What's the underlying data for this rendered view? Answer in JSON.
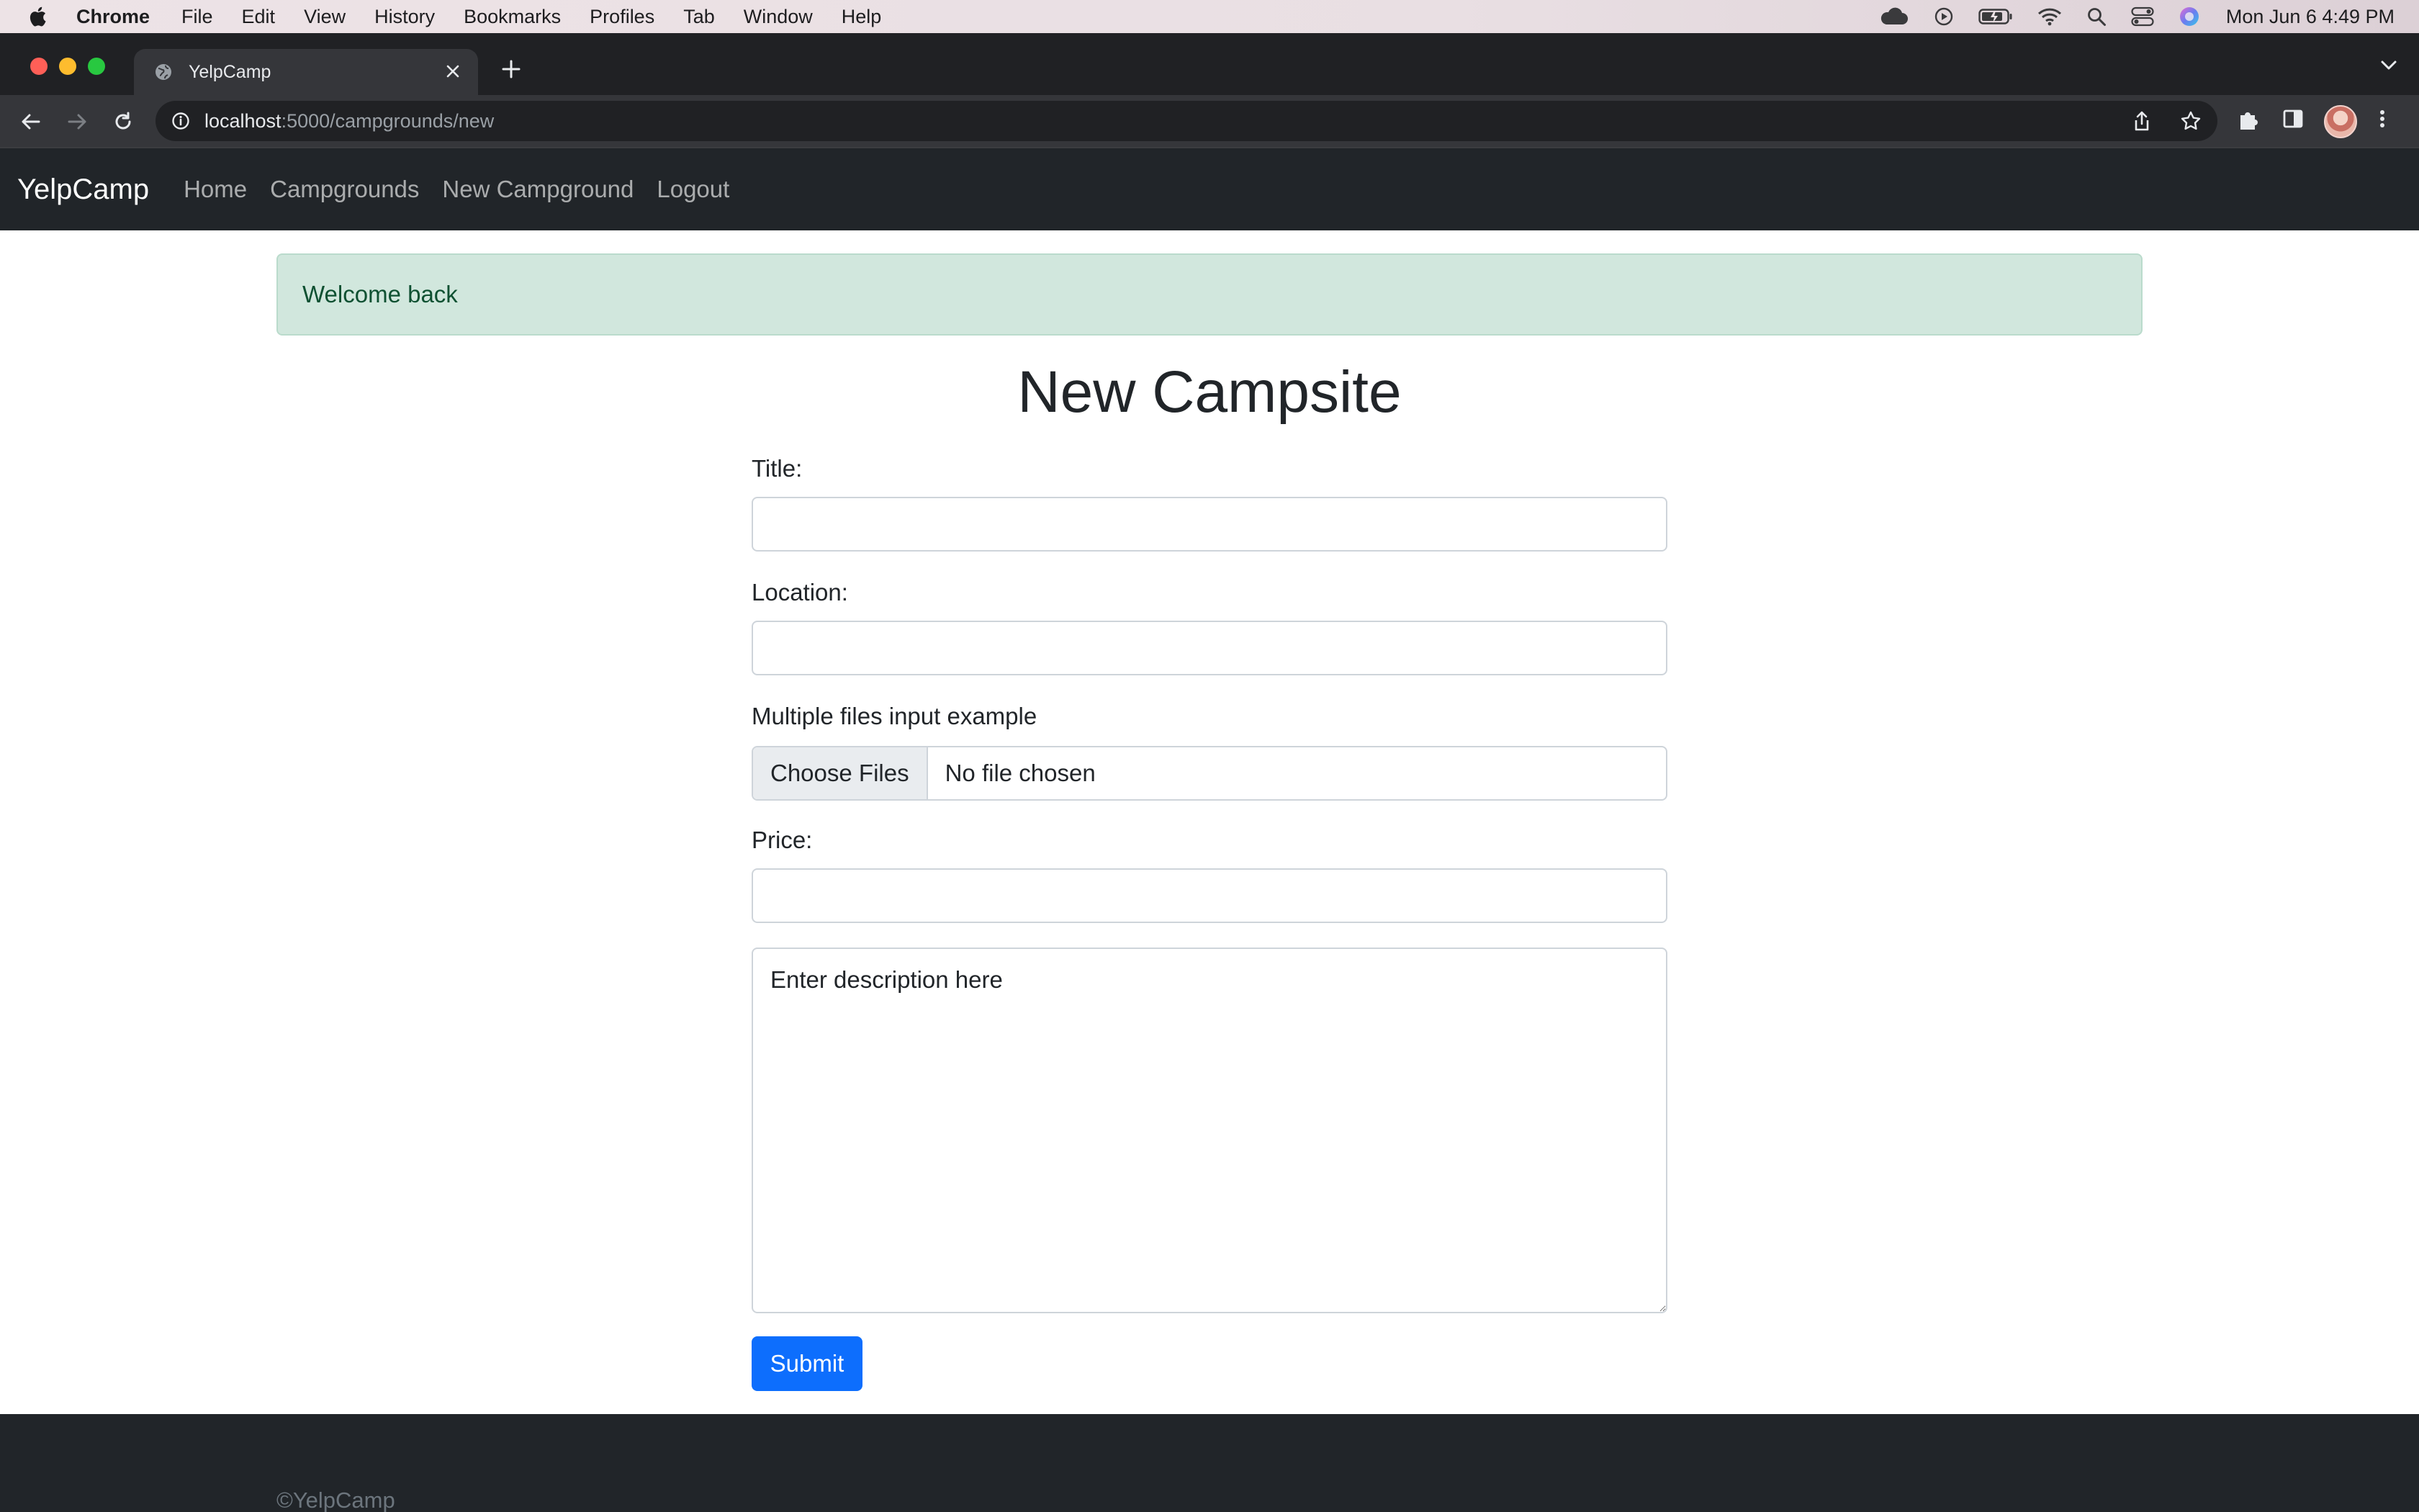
{
  "menubar": {
    "app_name": "Chrome",
    "items": [
      "File",
      "Edit",
      "View",
      "History",
      "Bookmarks",
      "Profiles",
      "Tab",
      "Window",
      "Help"
    ],
    "clock": "Mon Jun 6  4:49 PM",
    "status_icons": [
      "cloud-icon",
      "play-icon",
      "battery-icon",
      "wifi-icon",
      "search-icon",
      "control-center-icon",
      "siri-icon"
    ]
  },
  "browser": {
    "tab_title": "YelpCamp",
    "url_host": "localhost",
    "url_path": ":5000/campgrounds/new"
  },
  "site": {
    "brand": "YelpCamp",
    "nav": [
      "Home",
      "Campgrounds",
      "New Campground",
      "Logout"
    ]
  },
  "flash": {
    "message": "Welcome back",
    "colors": {
      "background": "#d1e7dd",
      "border": "#badbcc",
      "text": "#0f5132"
    }
  },
  "form": {
    "heading": "New Campsite",
    "title_label": "Title:",
    "title_value": "",
    "location_label": "Location:",
    "location_value": "",
    "files_label": "Multiple files input example",
    "files_button": "Choose Files",
    "files_status": "No file chosen",
    "price_label": "Price:",
    "price_value": "",
    "description_placeholder": "Enter description here",
    "submit_label": "Submit"
  },
  "footer": {
    "text": "©YelpCamp"
  },
  "colors": {
    "navbar": "#212529",
    "primary_button": "#0d6efd",
    "chrome_frame": "#202124",
    "chrome_toolbar": "#35363a"
  }
}
